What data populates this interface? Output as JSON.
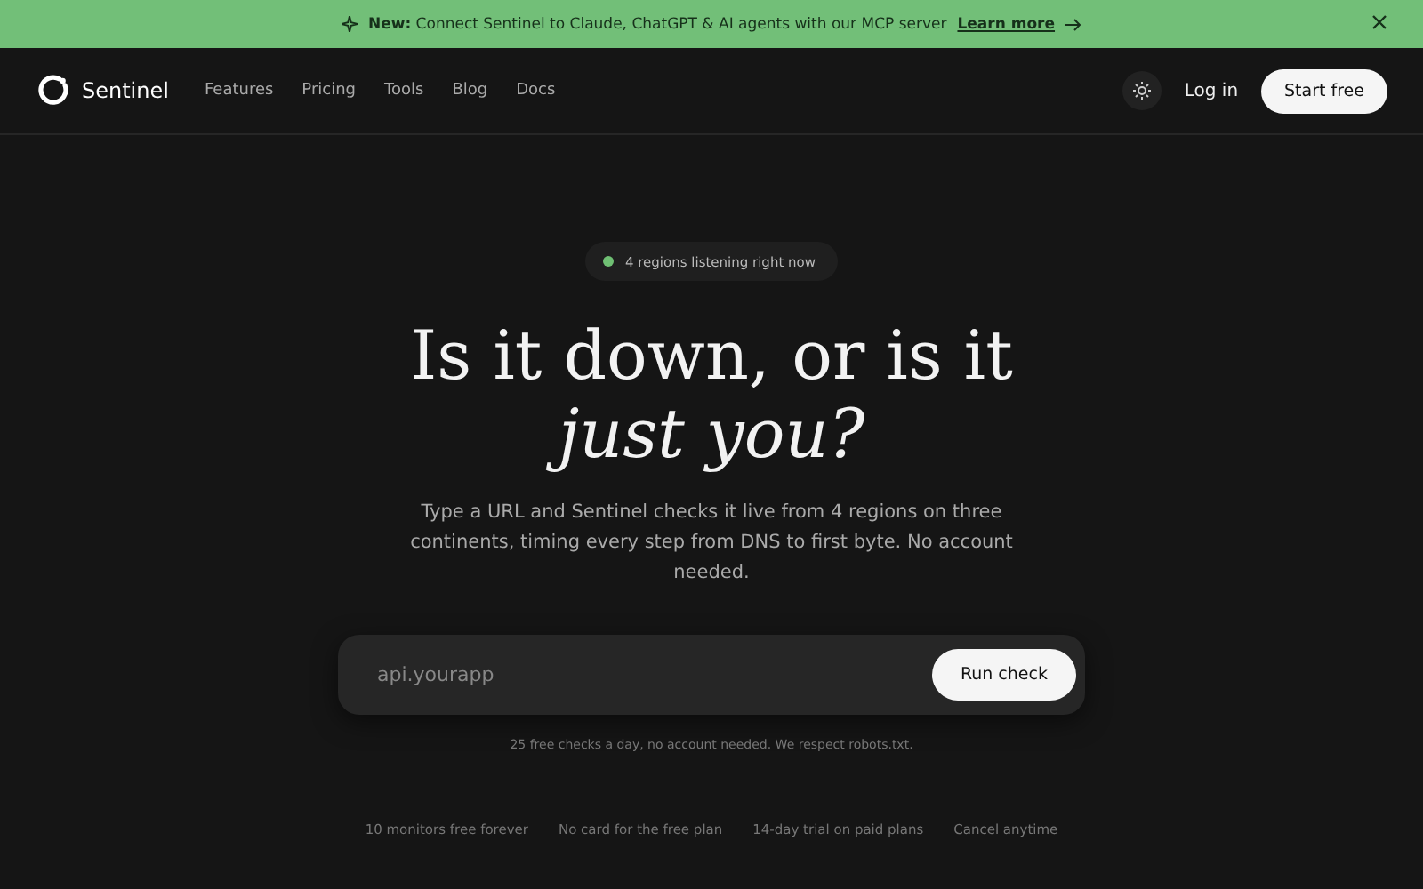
{
  "banner": {
    "message": "**New:** Connect Sentinel to Claude, ChatGPT & AI agents with our MCP server",
    "link": "Learn more"
  },
  "nav": {
    "brand": "Sentinel",
    "links": [
      "Features",
      "Pricing",
      "Tools",
      "Blog",
      "Docs"
    ],
    "login": "Log in",
    "cta": "Start free"
  },
  "hero": {
    "status": {
      "text": "4 regions listening right now",
      "color": "#6fbf73"
    },
    "headline": {
      "line_1": "Is it down, or is it",
      "line_2": "just you?"
    },
    "description": "Type a URL and Sentinel checks it live from 4 regions on three continents, timing every step from DNS to first byte. No account needed.",
    "search": {
      "placeholder": "api.yourapp",
      "button": "Run check"
    },
    "note": "25 free checks a day, no account needed. We respect robots.txt.",
    "perks": [
      "10 monitors free forever",
      "No card for the free plan",
      "14-day trial on paid plans",
      "Cancel anytime"
    ]
  }
}
